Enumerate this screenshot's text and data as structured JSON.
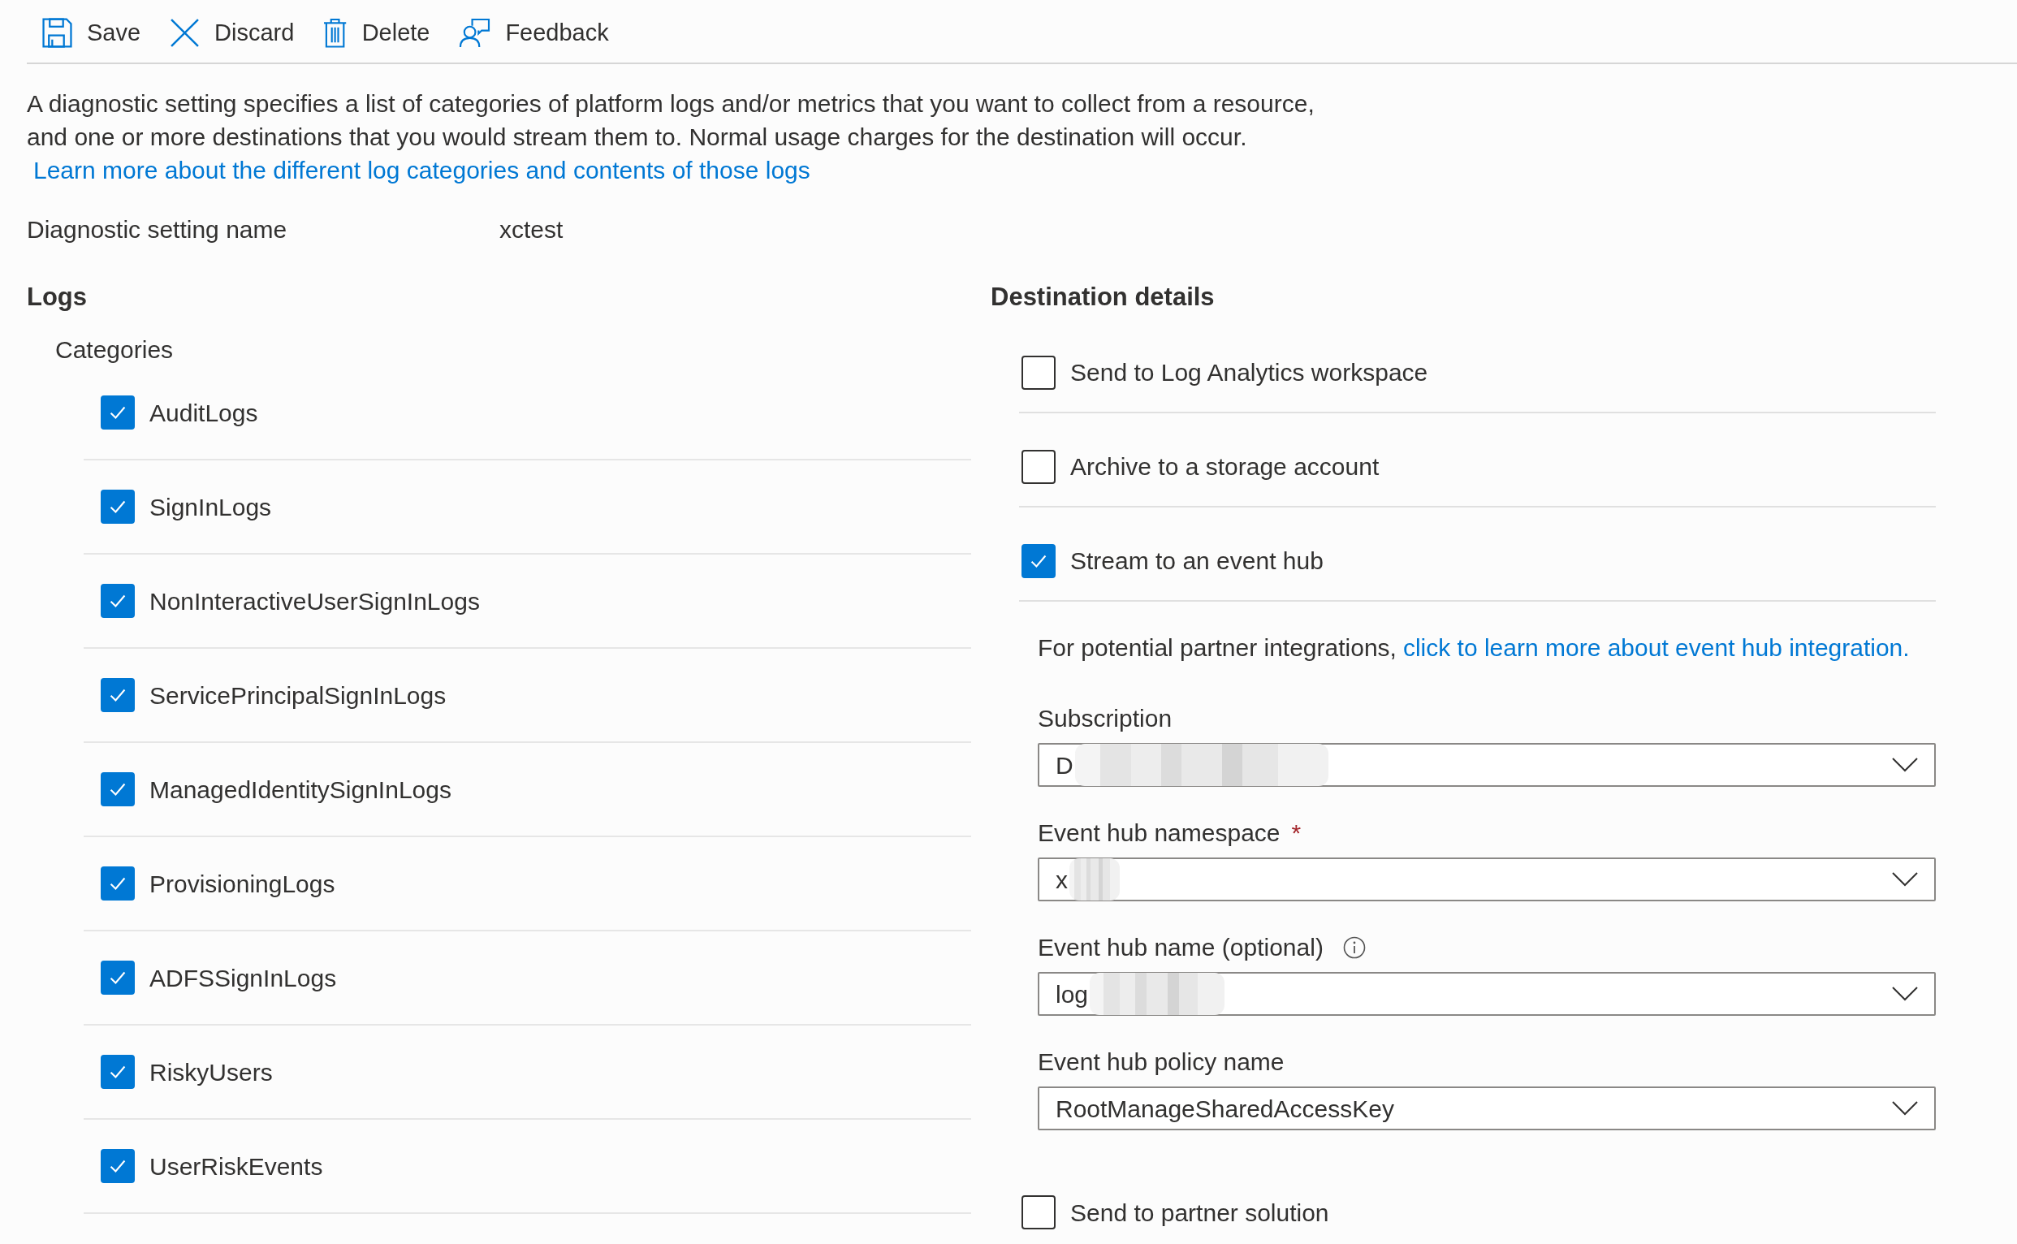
{
  "toolbar": [
    {
      "kind": "save",
      "label": "Save"
    },
    {
      "kind": "discard",
      "label": "Discard"
    },
    {
      "kind": "delete",
      "label": "Delete"
    },
    {
      "kind": "feedback",
      "label": "Feedback"
    }
  ],
  "description": {
    "text": "A diagnostic setting specifies a list of categories of platform logs and/or metrics that you want to collect from a resource, and one or more destinations that you would stream them to. Normal usage charges for the destination will occur.",
    "link": "Learn more about the different log categories and contents of those logs"
  },
  "setting_name": {
    "label": "Diagnostic setting name",
    "value": "xctest"
  },
  "logs": {
    "title": "Logs",
    "subtitle": "Categories",
    "categories": [
      {
        "label": "AuditLogs",
        "checked": true
      },
      {
        "label": "SignInLogs",
        "checked": true
      },
      {
        "label": "NonInteractiveUserSignInLogs",
        "checked": true
      },
      {
        "label": "ServicePrincipalSignInLogs",
        "checked": true
      },
      {
        "label": "ManagedIdentitySignInLogs",
        "checked": true
      },
      {
        "label": "ProvisioningLogs",
        "checked": true
      },
      {
        "label": "ADFSSignInLogs",
        "checked": true
      },
      {
        "label": "RiskyUsers",
        "checked": true
      },
      {
        "label": "UserRiskEvents",
        "checked": true
      }
    ]
  },
  "destination": {
    "title": "Destination details",
    "options": [
      {
        "label": "Send to Log Analytics workspace",
        "checked": false
      },
      {
        "label": "Archive to a storage account",
        "checked": false
      },
      {
        "label": "Stream to an event hub",
        "checked": true
      }
    ],
    "partner_note": {
      "text": "For potential partner integrations,",
      "link": "click to learn more about event hub integration."
    },
    "fields": [
      {
        "label": "Subscription",
        "value": "D",
        "redacted": true
      },
      {
        "label": "Event hub namespace",
        "required_mark": "*",
        "value": "x",
        "redacted": true
      },
      {
        "label": "Event hub name (optional)",
        "info": true,
        "value": "log",
        "redacted": true
      },
      {
        "label": "Event hub policy name",
        "value": "RootManageSharedAccessKey"
      }
    ],
    "partner_option": {
      "label": "Send to partner solution",
      "checked": false
    }
  }
}
